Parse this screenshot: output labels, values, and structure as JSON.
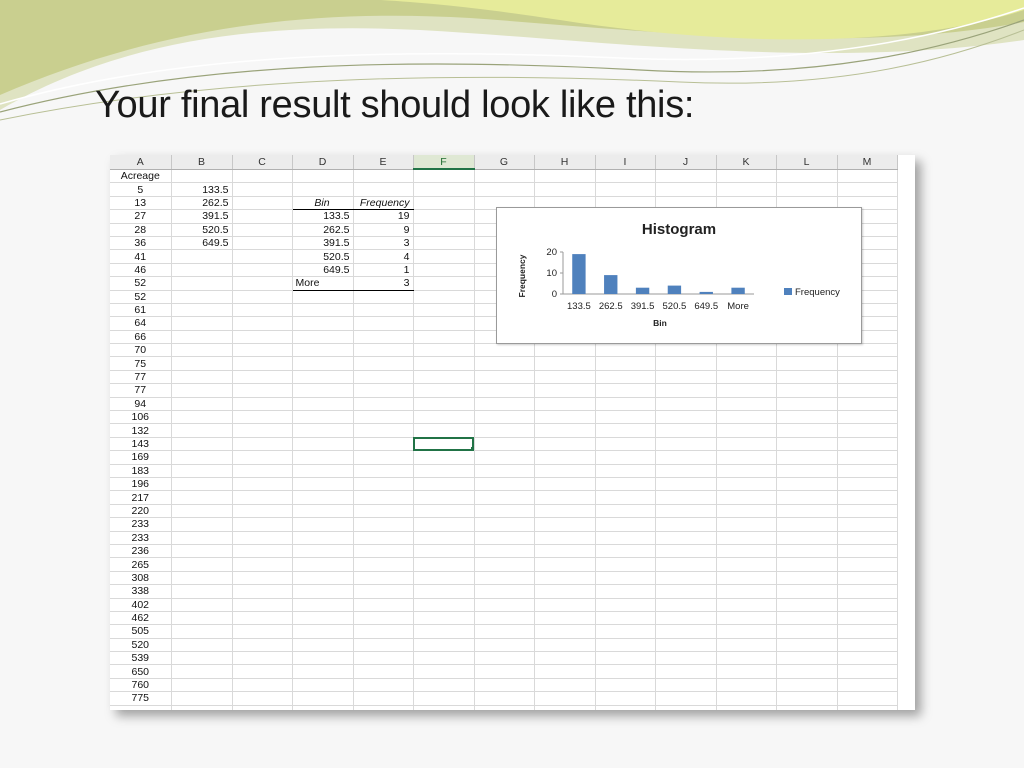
{
  "slide": {
    "title": "Your final result should look like this:"
  },
  "sheet": {
    "columns": [
      "A",
      "B",
      "C",
      "D",
      "E",
      "F",
      "G",
      "H",
      "I",
      "J",
      "K",
      "L",
      "M"
    ],
    "active_column": "F",
    "acreage_header": "Acreage",
    "acreage": [
      "5",
      "13",
      "27",
      "28",
      "36",
      "41",
      "46",
      "52",
      "52",
      "61",
      "64",
      "66",
      "70",
      "75",
      "77",
      "77",
      "94",
      "106",
      "132",
      "143",
      "169",
      "183",
      "196",
      "217",
      "220",
      "233",
      "233",
      "236",
      "265",
      "308",
      "338",
      "402",
      "462",
      "505",
      "520",
      "539",
      "650",
      "760",
      "775"
    ],
    "bins_b": [
      "133.5",
      "262.5",
      "391.5",
      "520.5",
      "649.5"
    ],
    "freq_table": {
      "header_bin": "Bin",
      "header_freq": "Frequency",
      "rows": [
        {
          "bin": "133.5",
          "freq": "19"
        },
        {
          "bin": "262.5",
          "freq": "9"
        },
        {
          "bin": "391.5",
          "freq": "3"
        },
        {
          "bin": "520.5",
          "freq": "4"
        },
        {
          "bin": "649.5",
          "freq": "1"
        },
        {
          "bin": "More",
          "freq": "3"
        }
      ]
    }
  },
  "chart_data": {
    "type": "bar",
    "title": "Histogram",
    "xlabel": "Bin",
    "ylabel": "Frequency",
    "categories": [
      "133.5",
      "262.5",
      "391.5",
      "520.5",
      "649.5",
      "More"
    ],
    "series": [
      {
        "name": "Frequency",
        "values": [
          19,
          9,
          3,
          4,
          1,
          3
        ],
        "color": "#4f81bd"
      }
    ],
    "ylim": [
      0,
      20
    ],
    "yticks": [
      "0",
      "10",
      "20"
    ],
    "legend": "right",
    "grid": false
  }
}
